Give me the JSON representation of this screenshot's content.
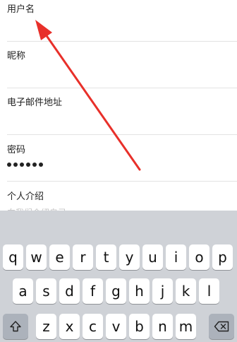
{
  "form": {
    "username": {
      "label": "用户名",
      "value": ""
    },
    "nickname": {
      "label": "昵称",
      "value": ""
    },
    "email": {
      "label": "电子邮件地址",
      "value": ""
    },
    "password": {
      "label": "密码",
      "value_mask_length": 6
    },
    "bio": {
      "label": "个人介绍",
      "placeholder": "向我们介绍自己"
    }
  },
  "keyboard": {
    "row1": [
      "q",
      "w",
      "e",
      "r",
      "t",
      "y",
      "u",
      "i",
      "o",
      "p"
    ],
    "row2": [
      "a",
      "s",
      "d",
      "f",
      "g",
      "h",
      "j",
      "k",
      "l"
    ],
    "row3": [
      "z",
      "x",
      "c",
      "v",
      "b",
      "n",
      "m"
    ],
    "shift_icon": "shift-icon",
    "delete_icon": "delete-icon"
  },
  "annotation": {
    "arrow_color": "#e8302a"
  }
}
